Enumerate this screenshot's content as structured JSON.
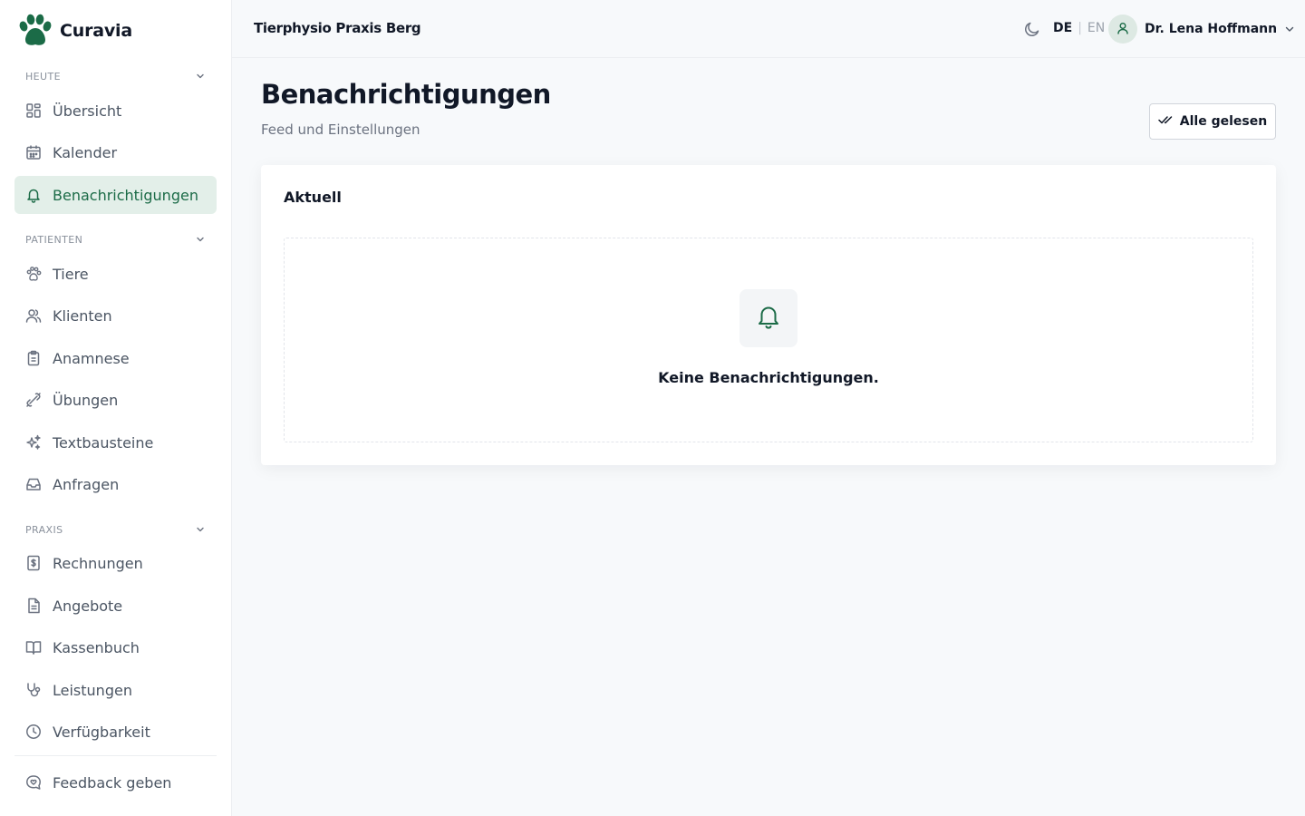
{
  "app": {
    "name": "Curavia"
  },
  "sidebar": {
    "sections": [
      {
        "label": "HEUTE",
        "items": [
          {
            "label": "Übersicht",
            "icon": "dashboard-icon"
          },
          {
            "label": "Kalender",
            "icon": "calendar-icon"
          },
          {
            "label": "Benachrichtigungen",
            "icon": "bell-icon",
            "active": true
          }
        ]
      },
      {
        "label": "PATIENTEN",
        "items": [
          {
            "label": "Tiere",
            "icon": "paw-icon"
          },
          {
            "label": "Klienten",
            "icon": "users-icon"
          },
          {
            "label": "Anamnese",
            "icon": "clipboard-icon"
          },
          {
            "label": "Übungen",
            "icon": "bone-icon"
          },
          {
            "label": "Textbausteine",
            "icon": "sparkles-icon"
          },
          {
            "label": "Anfragen",
            "icon": "inbox-icon"
          }
        ]
      },
      {
        "label": "PRAXIS",
        "items": [
          {
            "label": "Rechnungen",
            "icon": "invoice-icon"
          },
          {
            "label": "Angebote",
            "icon": "document-icon"
          },
          {
            "label": "Kassenbuch",
            "icon": "book-icon"
          },
          {
            "label": "Leistungen",
            "icon": "stethoscope-icon"
          },
          {
            "label": "Verfügbarkeit",
            "icon": "clock-icon"
          }
        ]
      }
    ],
    "feedback": {
      "label": "Feedback geben",
      "icon": "feedback-icon"
    }
  },
  "topbar": {
    "practice_name": "Tierphysio Praxis Berg",
    "lang": {
      "active": "DE",
      "separator": "|",
      "other": "EN"
    },
    "user_name": "Dr. Lena Hoffmann"
  },
  "page": {
    "title": "Benachrichtigungen",
    "subtitle": "Feed und Einstellungen",
    "mark_all_read": "Alle gelesen",
    "card_title": "Aktuell",
    "empty_message": "Keine Benachrichtigungen."
  },
  "colors": {
    "accent": "#1b6b47",
    "active_bg": "#e3efe9",
    "background": "#f7f9fb"
  }
}
